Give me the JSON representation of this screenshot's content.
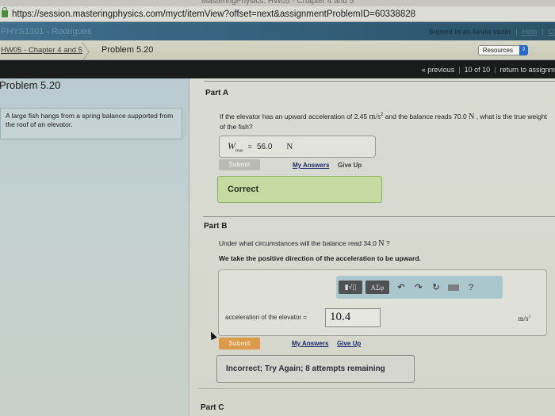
{
  "window": {
    "title": "MasteringPhysics: HW05 - Chapter 4 and 5"
  },
  "browser": {
    "url": "https://session.masteringphysics.com/myct/itemView?offset=next&assignmentProblemID=60338828"
  },
  "course_bar": {
    "course": "PHYS1301 - Rodrigues",
    "signed_in": "Signed in as kevin vazin",
    "help": "Help",
    "close": "Cl"
  },
  "breadcrumb": {
    "assignment": "HW05 - Chapter 4 and 5",
    "current": "Problem 5.20",
    "resources": "Resources",
    "resources_arrow": "⇕"
  },
  "pager": {
    "previous": "« previous",
    "position": "10 of 10",
    "return": "return to assignm"
  },
  "problem": {
    "title": "Problem 5.20",
    "text": "A large fish hangs from a spring balance supported from the roof of an elevator."
  },
  "part_a": {
    "label": "Part A",
    "question_pre": "If the elevator has an upward acceleration of 2.45 ",
    "question_unit1": "m/s",
    "question_sup": "2",
    "question_mid": " and the balance reads 70.0 ",
    "question_unit2": "N",
    "question_post": " , what is the true weight of the fish?",
    "var": "W",
    "var_sub": "true",
    "eq": "=",
    "answer": "56.0",
    "unit": "N",
    "submit": "Submit",
    "my_answers": "My Answers",
    "give_up": "Give Up",
    "feedback": "Correct"
  },
  "part_b": {
    "label": "Part B",
    "question_pre": "Under what circumstances will the balance read 34.0 ",
    "question_unit": "N",
    "question_post": " ?",
    "note": "We take the positive direction of the acceleration to be upward.",
    "toolbar": {
      "templates": "▮√▯",
      "symbols": "ΑΣφ",
      "undo": "↶",
      "redo": "↷",
      "reset": "↻",
      "help": "?"
    },
    "field_label": "acceleration of the elevator =",
    "answer": "10.4",
    "unit": "m/s",
    "unit_sup": "2",
    "submit": "Submit",
    "my_answers": "My Answers",
    "give_up": "Give Up",
    "feedback": "Incorrect; Try Again; 8 attempts remaining"
  },
  "part_c": {
    "label": "Part C"
  },
  "colors": {
    "course_bar": "#2f5a72",
    "submit_active": "#dd9a48",
    "correct_bg": "#c5dba2",
    "resources_select": "#2869c9"
  }
}
